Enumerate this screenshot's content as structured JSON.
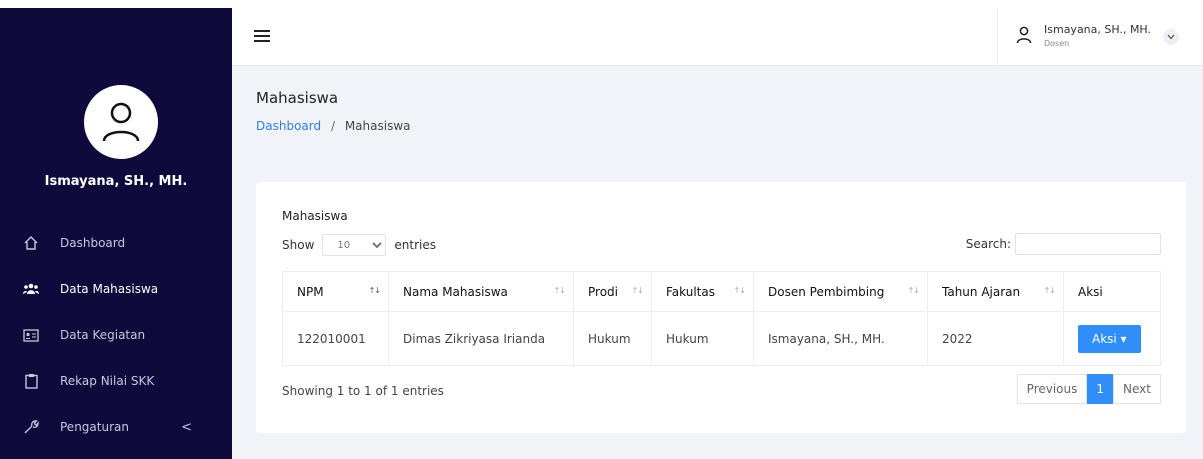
{
  "sidebar": {
    "user_name": "Ismayana, SH., MH.",
    "items": [
      {
        "label": "Dashboard",
        "icon": "home-icon"
      },
      {
        "label": "Data Mahasiswa",
        "icon": "users-icon"
      },
      {
        "label": "Data Kegiatan",
        "icon": "id-card-icon"
      },
      {
        "label": "Rekap Nilai SKK",
        "icon": "clipboard-icon"
      },
      {
        "label": "Pengaturan",
        "icon": "wrench-icon",
        "arrow": "<"
      }
    ]
  },
  "topbar": {
    "user_name": "Ismayana, SH., MH.",
    "user_role": "Dosen"
  },
  "page": {
    "title": "Mahasiswa",
    "breadcrumb_home": "Dashboard",
    "breadcrumb_sep": "/",
    "breadcrumb_current": "Mahasiswa"
  },
  "card": {
    "title": "Mahasiswa",
    "show_label": "Show",
    "entries_value": "10",
    "entries_label": "entries",
    "search_label": "Search:",
    "search_value": ""
  },
  "table": {
    "headers": [
      "NPM",
      "Nama Mahasiswa",
      "Prodi",
      "Fakultas",
      "Dosen Pembimbing",
      "Tahun Ajaran",
      "Aksi"
    ],
    "rows": [
      [
        "122010001",
        "Dimas Zikriyasa Irianda",
        "Hukum",
        "Hukum",
        "Ismayana, SH., MH.",
        "2022"
      ]
    ],
    "action_label": "Aksi ▾"
  },
  "footer": {
    "info": "Showing 1 to 1 of 1 entries",
    "previous": "Previous",
    "current_page": "1",
    "next": "Next"
  },
  "colors": {
    "sidebar_bg": "#0f0a3c",
    "accent": "#2f8ef7",
    "link": "#2f7fe0"
  }
}
